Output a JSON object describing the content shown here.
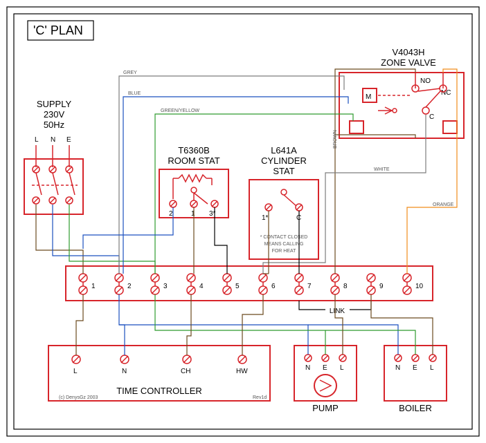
{
  "title": "'C' PLAN",
  "supply": {
    "label": "SUPPLY",
    "v": "230V",
    "hz": "50Hz",
    "L": "L",
    "N": "N",
    "E": "E"
  },
  "roomstat": {
    "label1": "T6360B",
    "label2": "ROOM STAT",
    "t1": "2",
    "t2": "1",
    "t3": "3*"
  },
  "cylstat": {
    "label1": "L641A",
    "label2": "CYLINDER",
    "label3": "STAT",
    "t1": "1*",
    "t2": "C",
    "note1": "* CONTACT CLOSED",
    "note2": "MEANS CALLING",
    "note3": "FOR HEAT"
  },
  "zonevalve": {
    "label1": "V4043H",
    "label2": "ZONE VALVE",
    "M": "M",
    "NO": "NO",
    "NC": "NC",
    "C": "C"
  },
  "junction": {
    "t": [
      "1",
      "2",
      "3",
      "4",
      "5",
      "6",
      "7",
      "8",
      "9",
      "10"
    ],
    "link": "LINK"
  },
  "timectrl": {
    "label": "TIME CONTROLLER",
    "L": "L",
    "N": "N",
    "CH": "CH",
    "HW": "HW"
  },
  "pump": {
    "label": "PUMP",
    "N": "N",
    "E": "E",
    "L": "L"
  },
  "boiler": {
    "label": "BOILER",
    "N": "N",
    "E": "E",
    "L": "L"
  },
  "wires": {
    "grey": "GREY",
    "blue": "BLUE",
    "gy": "GREEN/YELLOW",
    "brown": "BROWN",
    "white": "WHITE",
    "orange": "ORANGE"
  },
  "credit": "(c) DenysGz 2003",
  "rev": "Rev1d"
}
